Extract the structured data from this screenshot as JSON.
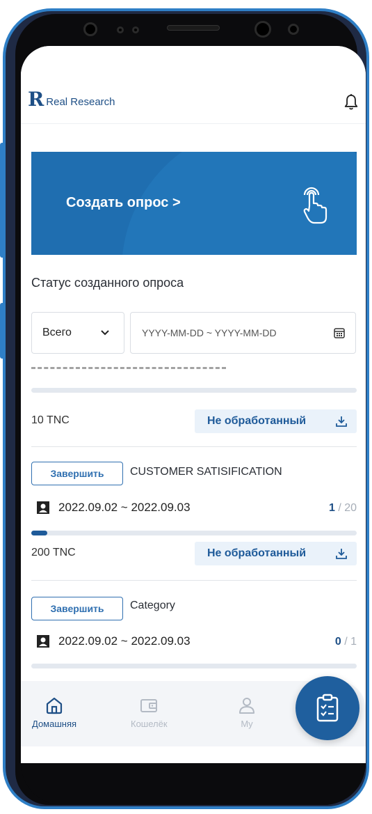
{
  "app": {
    "brand_mark": "R",
    "brand_name": "Real Research"
  },
  "banner": {
    "label": "Создать опрос >"
  },
  "section": {
    "title": "Статус созданного опроса"
  },
  "filter": {
    "selected": "Всего",
    "date_placeholder": "YYYY-MM-DD ~ YYYY-MM-DD"
  },
  "surveys": [
    {
      "reward": "10 TNC",
      "status": "Не обработанный",
      "progress": 0
    },
    {
      "finish_label": "Завершить",
      "name": "CUSTOMER SATISIFICATION",
      "dates": "2022.09.02 ~ 2022.09.03",
      "count_current": "1",
      "count_total": "/ 20",
      "progress": 0.05,
      "reward": "200 TNC",
      "status": "Не обработанный"
    },
    {
      "finish_label": "Завершить",
      "name": "Category",
      "dates": "2022.09.02 ~ 2022.09.03",
      "count_current": "0",
      "count_total": "/ 1",
      "progress": 0
    }
  ],
  "nav": [
    {
      "label": "Домашняя",
      "icon": "home-icon",
      "active": true
    },
    {
      "label": "Кошелёк",
      "icon": "wallet-icon",
      "active": false
    },
    {
      "label": "My",
      "icon": "person-icon",
      "active": false
    }
  ],
  "fab": {
    "icon": "survey-checklist-icon"
  },
  "colors": {
    "primary": "#1f6eb0",
    "accent": "#1e5a99",
    "nav_inactive": "#b3bac4"
  }
}
